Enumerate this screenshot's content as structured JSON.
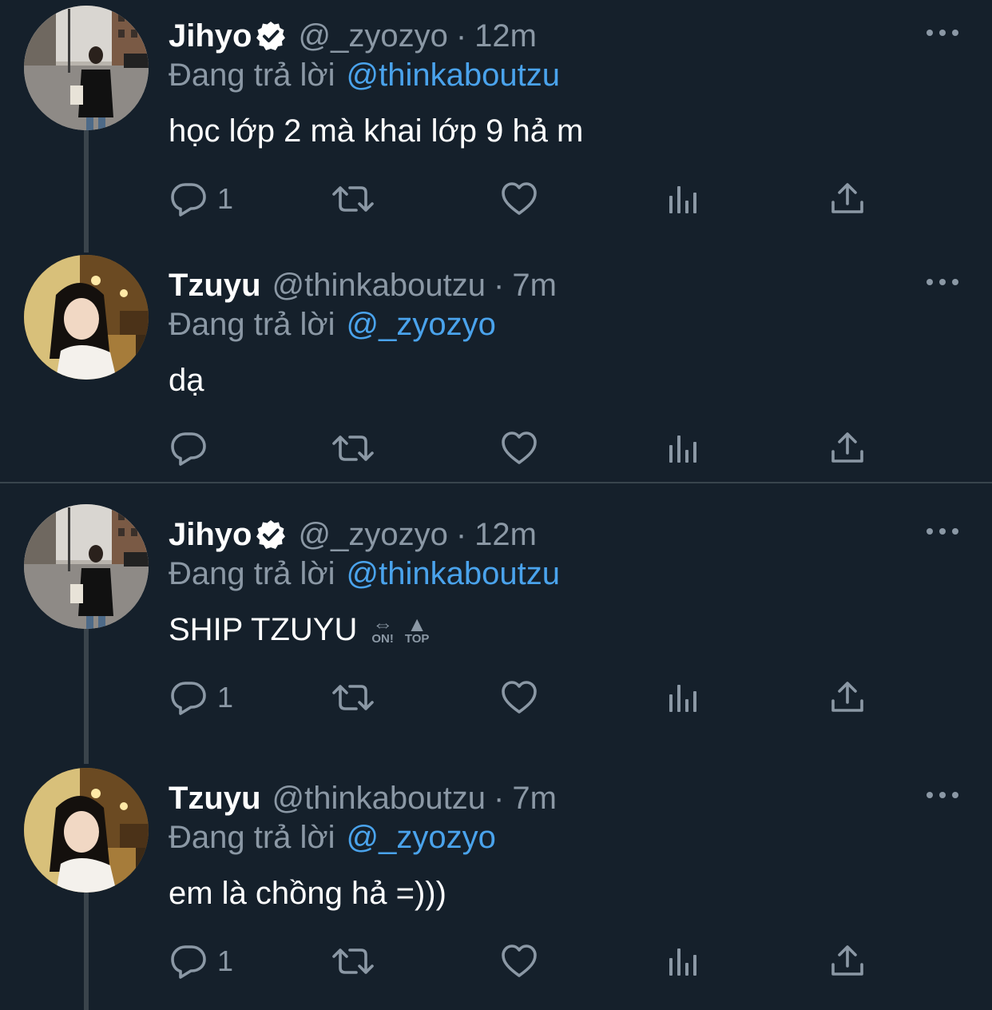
{
  "tweets": [
    {
      "name": "Jihyo",
      "verified": true,
      "handle": "@_zyozyo",
      "time": "12m",
      "replying_label": "Đang trả lời",
      "replying_to": "@thinkaboutzu",
      "text": "học lớp 2 mà khai lớp 9 hả m",
      "reply_count": "1",
      "avatar": "street-photo"
    },
    {
      "name": "Tzuyu",
      "verified": false,
      "handle": "@thinkaboutzu",
      "time": "7m",
      "replying_label": "Đang trả lời",
      "replying_to": "@_zyozyo",
      "text": "dạ",
      "reply_count": "",
      "avatar": "cafe-photo"
    },
    {
      "name": "Jihyo",
      "verified": true,
      "handle": "@_zyozyo",
      "time": "12m",
      "replying_label": "Đang trả lời",
      "replying_to": "@thinkaboutzu",
      "text": "SHIP TZUYU",
      "emoji": [
        {
          "glyph": "⇔",
          "label": "ON!"
        },
        {
          "glyph": "▲",
          "label": "TOP"
        }
      ],
      "reply_count": "1",
      "avatar": "street-photo"
    },
    {
      "name": "Tzuyu",
      "verified": false,
      "handle": "@thinkaboutzu",
      "time": "7m",
      "replying_label": "Đang trả lời",
      "replying_to": "@_zyozyo",
      "text": "em là chồng hả =)))",
      "reply_count": "1",
      "avatar": "cafe-photo"
    }
  ],
  "separator": "·",
  "icons": [
    "reply-icon",
    "retweet-icon",
    "like-icon",
    "analytics-icon",
    "share-icon",
    "more-icon",
    "verified-badge-icon"
  ],
  "colors": {
    "background": "#15202b",
    "secondary_text": "#8b98a5",
    "mention": "#4aa3ec",
    "thread_line": "#3a444c"
  }
}
